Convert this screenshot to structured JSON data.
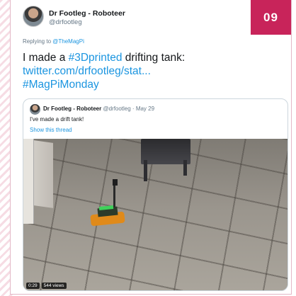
{
  "badge": "09",
  "tweet": {
    "author_name": "Dr Footleg - Roboteer",
    "author_handle": "@drfootleg",
    "reply_prefix": "Replying to",
    "reply_to": "@TheMagPi",
    "line1_text": "I made a ",
    "line1_hashtag": "#3Dprinted",
    "line1_rest": " drifting tank:",
    "link": "twitter.com/drfootleg/stat...",
    "hashtag2": "#MagPiMonday"
  },
  "quoted": {
    "author_name": "Dr Footleg - Roboteer",
    "meta": "@drfootleg · May 29",
    "text": "I've made a drift tank!",
    "show_thread": "Show this thread",
    "video_time": "0:29",
    "video_views": "544 views"
  },
  "colors": {
    "accent": "#c8245a",
    "link": "#1b95e0",
    "tank": "#e08a1a"
  }
}
